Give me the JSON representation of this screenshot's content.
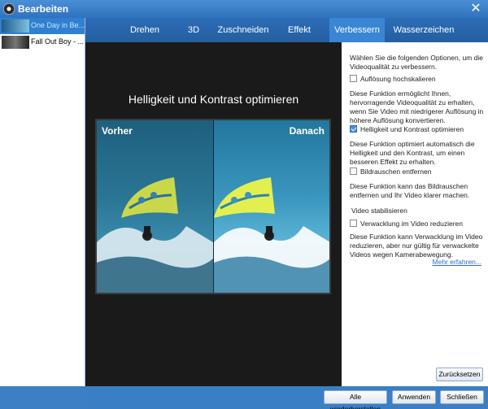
{
  "window": {
    "title": "Bearbeiten",
    "close_glyph": "✕"
  },
  "sidebar": {
    "items": [
      {
        "label": "One Day in Be..."
      },
      {
        "label": "Fall Out Boy - ..."
      }
    ]
  },
  "tabs": [
    {
      "label": "Drehen"
    },
    {
      "label": "3D"
    },
    {
      "label": "Zuschneiden"
    },
    {
      "label": "Effekt"
    },
    {
      "label": "Verbessern",
      "active": true
    },
    {
      "label": "Wasserzeichen"
    }
  ],
  "preview": {
    "heading": "Helligkeit und Kontrast optimieren",
    "before_label": "Vorher",
    "after_label": "Danach"
  },
  "options": {
    "intro": "Wählen Sie die folgenden Optionen, um die Videoqualität zu verbessern.",
    "upscale": {
      "label": "Auflösung hochskalieren",
      "checked": false,
      "description": "Diese Funktion ermöglicht Ihnen, hervorragende Videoqualität zu erhalten, wenn Sie Video mit niedrigerer Auflösung in höhere Auflösung konvertieren."
    },
    "brightness": {
      "label": "Helligkeit und Kontrast optimieren",
      "checked": true,
      "description": "Diese Funktion optimiert automatisch die Helligkeit und den Kontrast, um einen besseren Effekt zu erhalten."
    },
    "denoise": {
      "label": "Bildrauschen entfernen",
      "checked": false,
      "description": "Diese Funktion kann das Bildrauschen entfernen und Ihr Video klarer machen."
    },
    "stabilize_section": "Video stabilisieren",
    "shake": {
      "label": "Verwacklung im Video reduzieren",
      "checked": false,
      "description": "Diese Funktion kann Verwacklung im Video reduzieren, aber nur gültig für verwackelte Videos wegen Kamerabewegung."
    },
    "more_link": "Mehr erfahren...",
    "reset_button": "Zurücksetzen"
  },
  "footer": {
    "restore_all": "Alle wiederherstellen",
    "apply": "Anwenden",
    "close": "Schließen"
  },
  "colors": {
    "accent": "#2f80d0",
    "frame": "#3a7fc6",
    "preview_bg": "#1a1a1a"
  }
}
